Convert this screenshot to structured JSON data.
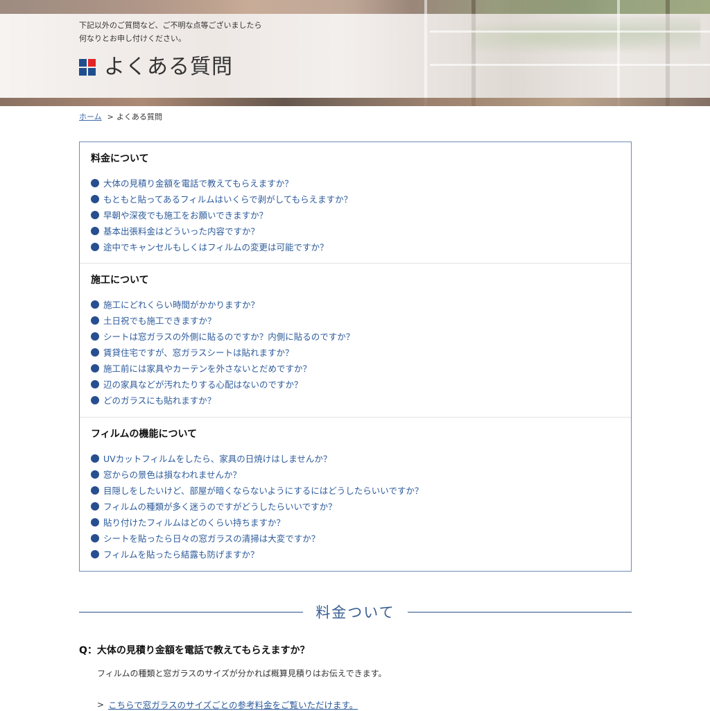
{
  "hero": {
    "lead_line1": "下記以外のご質問など、ご不明な点等ございましたら",
    "lead_line2": "何なりとお申し付けください。",
    "title": "よくある質問"
  },
  "breadcrumb": {
    "home": "ホーム",
    "separator": ">",
    "current": "よくある質問"
  },
  "index": {
    "sections": [
      {
        "heading": "料金について",
        "items": [
          "大体の見積り金額を電話で教えてもらえますか？",
          "もともと貼ってあるフィルムはいくらで剥がしてもらえますか？",
          "早朝や深夜でも施工をお願いできますか？",
          "基本出張料金はどういった内容ですか？",
          "途中でキャンセルもしくはフィルムの変更は可能ですか？"
        ]
      },
      {
        "heading": "施工について",
        "items": [
          "施工にどれくらい時間がかかりますか？",
          "土日祝でも施工できますか？",
          "シートは窓ガラスの外側に貼るのですか？内側に貼るのですか？",
          "賃貸住宅ですが、窓ガラスシートは貼れますか？",
          "施工前には家具やカーテンを外さないとだめですか？",
          "辺の家具などが汚れたりする心配はないのですか？",
          "どのガラスにも貼れますか？"
        ]
      },
      {
        "heading": "フィルムの機能について",
        "items": [
          "UVカットフィルムをしたら、家具の日焼けはしませんか？",
          "窓からの景色は損なわれませんか？",
          "目隠しをしたいけど、部屋が暗くならないようにするにはどうしたらいいですか？",
          "フィルムの種類が多く迷うのですがどうしたらいいですか？",
          "貼り付けたフィルムはどのくらい持ちますか？",
          "シートを貼ったら日々の窓ガラスの清掃は大変ですか？",
          "フィルムを貼ったら結露も防げますか？"
        ]
      }
    ]
  },
  "section": {
    "title": "料金ついて"
  },
  "qa": {
    "question": "Q：大体の見積り金額を電話で教えてもらえますか？",
    "answer": "フィルムの種類と窓ガラスのサイズが分かれば概算見積りはお伝えできます。",
    "link_chevron": ">",
    "link_text": "こちらで窓ガラスのサイズごとの参考料金をご覧いただけます。"
  },
  "colors": {
    "accent_blue": "#274e8f",
    "link_blue": "#2d5b9b",
    "logo_red": "#e12525"
  }
}
